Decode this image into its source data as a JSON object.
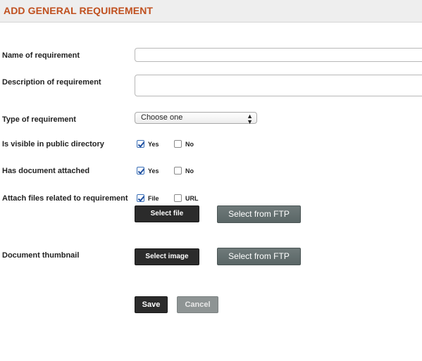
{
  "header": {
    "title": "ADD GENERAL REQUIREMENT"
  },
  "form": {
    "name_label": "Name of requirement",
    "name_value": "",
    "description_label": "Description of requirement",
    "description_value": "",
    "type_label": "Type of requirement",
    "type_selected": "Choose one",
    "visible_label": "Is visible in public directory",
    "visible_yes": "Yes",
    "visible_no": "No",
    "visible_yes_checked": true,
    "visible_no_checked": false,
    "document_label": "Has document attached",
    "document_yes": "Yes",
    "document_no": "No",
    "document_yes_checked": true,
    "document_no_checked": false,
    "attach_label": "Attach files related to requirement",
    "attach_file": "File",
    "attach_url": "URL",
    "attach_file_checked": true,
    "attach_url_checked": false,
    "select_file_label": "Select file",
    "select_ftp_label": "Select from FTP",
    "thumbnail_label": "Document thumbnail",
    "select_image_label": "Select image",
    "thumbnail_ftp_label": "Select from FTP"
  },
  "actions": {
    "save_label": "Save",
    "cancel_label": "Cancel"
  },
  "colors": {
    "title": "#c0501f",
    "dark_button": "#2b2b2b",
    "ftp_button": "#5f6b6b"
  }
}
